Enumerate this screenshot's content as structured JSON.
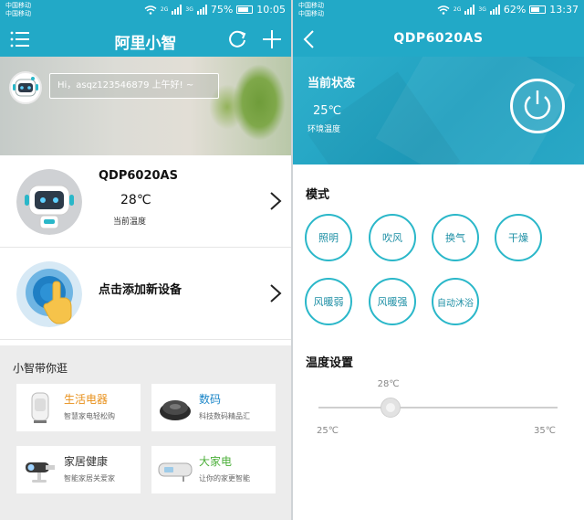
{
  "left": {
    "status": {
      "carrier1": "中国移动",
      "carrier2": "中国移动",
      "net1": "2G",
      "net2": "3G",
      "battery_text": "75%",
      "battery_fraction": 0.75,
      "time": "10:05"
    },
    "appbar": {
      "title": "阿里小智"
    },
    "banner": {
      "greeting": "Hi，asqz123546879 上午好! ~"
    },
    "device": {
      "name": "QDP6020AS",
      "temp": "28℃",
      "temp_label": "当前温度"
    },
    "add_device": {
      "label": "点击添加新设备"
    },
    "browse": {
      "title": "小智带你逛",
      "cards": [
        {
          "title": "生活电器",
          "subtitle": "智慧家电轻松购",
          "color": "#e8901a"
        },
        {
          "title": "数码",
          "subtitle": "科技数码精品汇",
          "color": "#1b86c8"
        },
        {
          "title": "家居健康",
          "subtitle": "智能家居关爱家",
          "color": "#333333"
        },
        {
          "title": "大家电",
          "subtitle": "让你的家更智能",
          "color": "#4caf3a"
        }
      ]
    }
  },
  "right": {
    "status": {
      "carrier1": "中国移动",
      "carrier2": "中国移动",
      "net1": "2G",
      "net2": "3G",
      "battery_text": "62%",
      "battery_fraction": 0.62,
      "time": "13:37"
    },
    "appbar": {
      "title": "QDP6020AS"
    },
    "state": {
      "label": "当前状态",
      "temp": "25℃",
      "temp_label": "环境温度"
    },
    "mode": {
      "title": "模式",
      "buttons": [
        "照明",
        "吹风",
        "换气",
        "干燥",
        "风暖弱",
        "风暖强",
        "自动沐浴"
      ]
    },
    "temperature": {
      "title": "温度设置",
      "value_label": "28℃",
      "min_label": "25℃",
      "max_label": "35℃",
      "min": 25,
      "max": 35,
      "value": 28
    }
  },
  "colors": {
    "accent": "#22a9c7",
    "mode_border": "#2ab7c9"
  }
}
